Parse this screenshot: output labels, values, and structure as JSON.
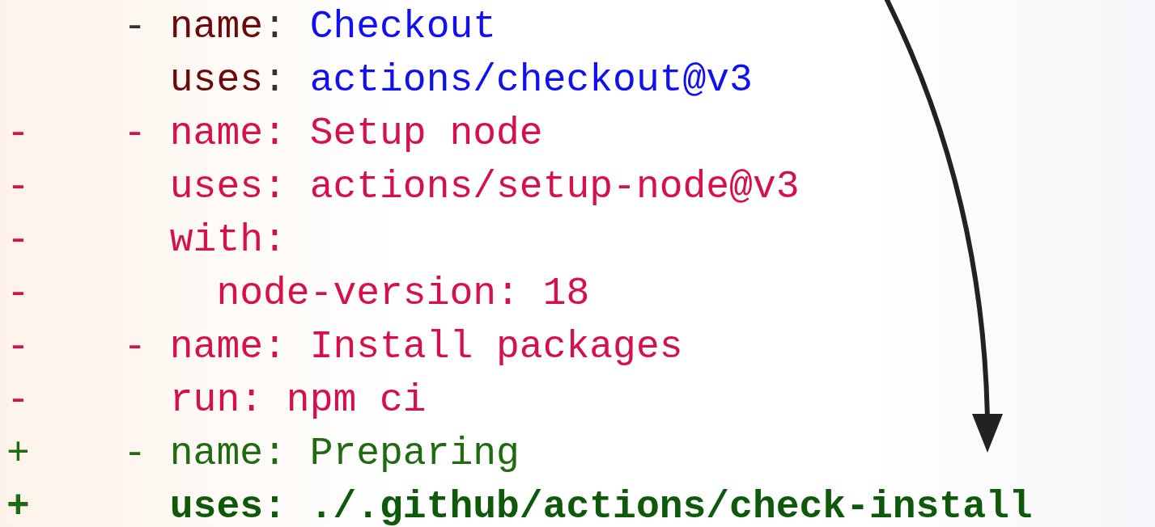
{
  "diff": {
    "lines": [
      {
        "kind": "context",
        "bullet": "-",
        "key": "name",
        "sep": ": ",
        "value": "Checkout"
      },
      {
        "kind": "context",
        "key": "uses",
        "sep": ": ",
        "value": "actions/checkout@v3"
      },
      {
        "kind": "removed",
        "marker": "-",
        "bullet": "-",
        "key": "name",
        "sep": ": ",
        "value": "Setup node"
      },
      {
        "kind": "removed",
        "marker": "-",
        "key": "uses",
        "sep": ": ",
        "value": "actions/setup-node@v3"
      },
      {
        "kind": "removed",
        "marker": "-",
        "key": "with",
        "sep": ":",
        "children": [
          {
            "kind": "removed",
            "marker": "-",
            "key": "node-version",
            "sep": ": ",
            "value": "18"
          }
        ]
      },
      {
        "kind": "removed",
        "marker": "-",
        "bullet": "-",
        "key": "name",
        "sep": ": ",
        "value": "Install packages"
      },
      {
        "kind": "removed",
        "marker": "-",
        "key": "run",
        "sep": ": ",
        "value": "npm ci"
      },
      {
        "kind": "added",
        "marker": "+",
        "bullet": "-",
        "key": "name",
        "sep": ": ",
        "value": "Preparing"
      },
      {
        "kind": "added_bold",
        "marker": "+",
        "key": "uses",
        "sep": ": ",
        "value": "./.github/actions/check-install"
      }
    ]
  }
}
